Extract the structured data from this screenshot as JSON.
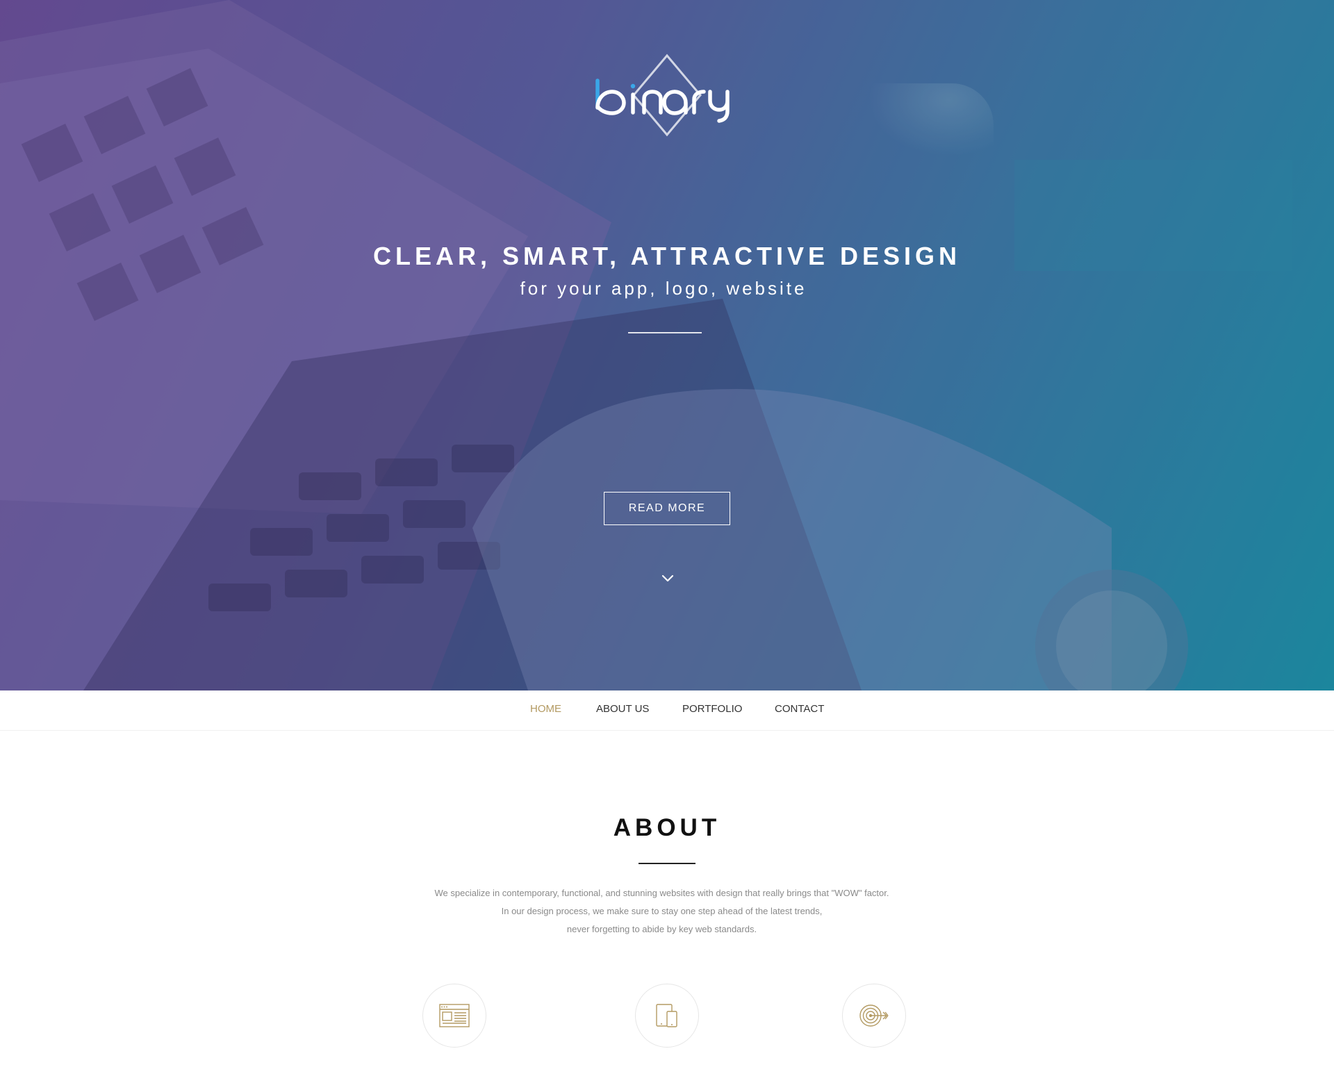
{
  "hero": {
    "logo_text": "binary",
    "title": "CLEAR, SMART, ATTRACTIVE DESIGN",
    "subtitle": "for your app, logo, website",
    "cta_label": "READ MORE",
    "scroll_icon": "chevron-down-icon",
    "gradient_colors": [
      "#6b4f96",
      "#3d7aa3",
      "#1a94a6"
    ]
  },
  "nav": {
    "items": [
      {
        "label": "HOME",
        "active": true
      },
      {
        "label": "ABOUT US",
        "active": false
      },
      {
        "label": "PORTFOLIO",
        "active": false
      },
      {
        "label": "CONTACT",
        "active": false
      }
    ],
    "accent_color": "#b39a62"
  },
  "about": {
    "title": "ABOUT",
    "lines": [
      "We specialize in contemporary, functional, and stunning websites with design that really brings that \"WOW\" factor.",
      "In our design process, we make sure to stay one step ahead of the latest trends,",
      "never forgetting to abide by key web standards."
    ],
    "features": [
      {
        "icon": "browser-layout-icon"
      },
      {
        "icon": "responsive-devices-icon"
      },
      {
        "icon": "target-icon"
      }
    ]
  }
}
